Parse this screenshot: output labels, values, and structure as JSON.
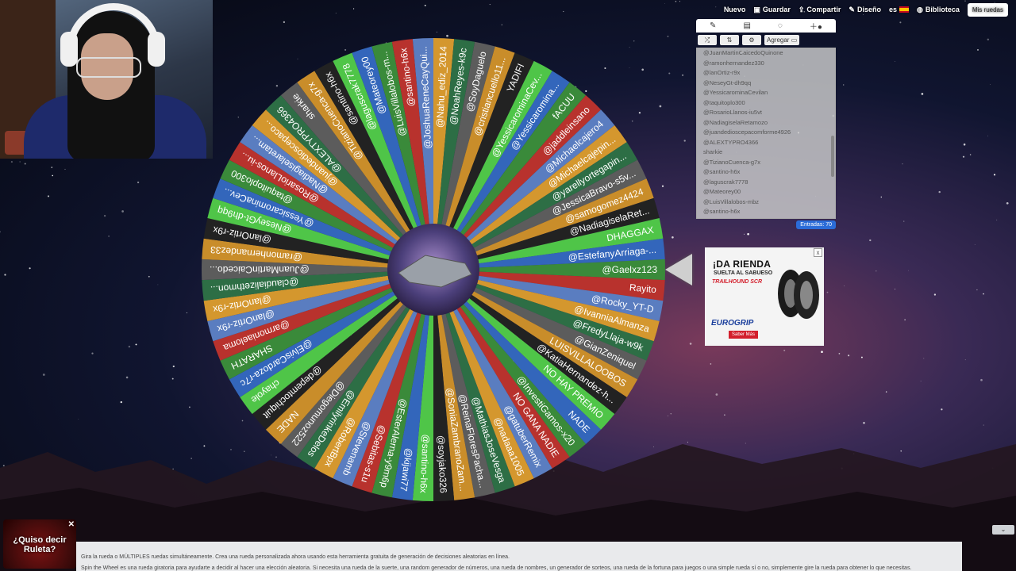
{
  "topnav": {
    "items": [
      {
        "label": "Nuevo",
        "icon": ""
      },
      {
        "label": "Guardar",
        "icon": "save-icon"
      },
      {
        "label": "Compartir",
        "icon": "share-icon"
      },
      {
        "label": "Diseño",
        "icon": "pen-icon"
      },
      {
        "label": "es",
        "icon": "flag-es-icon"
      },
      {
        "label": "Biblioteca",
        "icon": "globe-icon"
      }
    ],
    "my_wheels": "Mis ruedas"
  },
  "panel": {
    "add_label": "Agregar",
    "entries_count": "Entradas: 70",
    "entries": [
      "@JuanMartinCaicedoQuinone",
      "@ramonhernandez330",
      "@lanOrtiz-r9x",
      "@NeseyGt-dh9qq",
      "@YessicarominaCevilan",
      "@taquitoplo300",
      "@RosarioLlanos-iu5vt",
      "@NadiagiselaRetamozo",
      "@juandedioscepacomforme4926",
      "@ALEXTYPRO4366",
      "sharkie",
      "@TizianoCuenca-g7x",
      "@santino-h6x",
      "@laguscrak7778",
      "@Mateorey00",
      "@LuisVillalobos-mbz",
      "@santino-h6x"
    ]
  },
  "wheel": {
    "entries": [
      "@Gaelxz123",
      "Rayito",
      "@Rocky_YT-D",
      "@IvanniaAlmanza",
      "@FredyLlaja-w9k",
      "@GianZeniquel",
      "LUISVILLALOOBOS",
      "@KatiaHernandez-h...",
      "NO HAY PREMIO",
      "NADE",
      "@InvestiGamos-x20",
      "NO GANA NADIE",
      "@gatuberRemix",
      "@nadaaa1005",
      "@MathiasJoseVesga",
      "@ReinaFloresPacha...",
      "@SoniaZambranoZam...",
      "@soyjako326",
      "@santino-h6x",
      "@kijawi77",
      "@EsterAlerna-y9m6p",
      "@Sebitas-s1u",
      "@Stevenamb",
      "@RobertBpx",
      "@EmilyrinkeDelos",
      "@Diegomunoz522",
      "NADE",
      "@depemtochiquit",
      "chayole",
      "@ElvisCardoza-r7c",
      "SHARATH",
      "@armoniaeloma",
      "@lanOrtiz-r9x",
      "@lanOrtiz-r9x",
      "@claudializethmon...",
      "@JuanMartinCaicedo...",
      "@ramonhernandez33",
      "@lanOrtiz-r9x",
      "@NeseyGt-dh9qq",
      "@YessicarominaCev...",
      "@taquitoplo300",
      "@RosarioLlanos-iu...",
      "@Nadiagiselaretam...",
      "@juandedioscepaco...",
      "@ALEXTYPRO4366",
      "sharkie",
      "@TizianoCuenca-g7x",
      "@santino-h6x",
      "@laguscrak7778",
      "@Mateorey00",
      "@LuisVillalobos-m...",
      "@santino-h6x",
      "@JoshuaReneCayQui...",
      "@Nahu_ediz_2014",
      "@NoahReyes-k9c",
      "@SoyDaguelo",
      "@cristiancuello11...",
      "YADIFI",
      "@YessicarominaCev...",
      "@Yessicaromina...",
      "fACUU",
      "@jaddleinsano",
      "@Michaelcajero4",
      "@Michaelcajepin...",
      "@yarellyortegapin...",
      "@JessicaBravo-s5v...",
      "@samogomez4424",
      "@NadiagiselaRet...",
      "DHAGGAX",
      "@EstefanyArriaga-..."
    ],
    "colors": [
      "#3a8a3a",
      "#b8322d",
      "#5a7dc0",
      "#d4972e",
      "#2d6e45",
      "#5c5c5c",
      "#c98d2a",
      "#222222",
      "#4fc548",
      "#3366bb"
    ]
  },
  "ad": {
    "headline": "¡DA RIENDA",
    "subline": "SUELTA AL SABUESO",
    "product": "TRAILHOUND SCR",
    "brand": "EUROGRIP",
    "cta": "Saber Más",
    "close": "x"
  },
  "popup": {
    "text": "¿Quiso decir Ruleta?",
    "close": "✕"
  },
  "info": {
    "line1": "Gira la rueda o MÚLTIPLES ruedas simultáneamente. Crea una rueda personalizada ahora usando esta herramienta gratuita de generación de decisiones aleatorias en línea.",
    "line2": "Spin the Wheel es una rueda giratoria para ayudarte a decidir al hacer una elección aleatoria. Si necesita una rueda de la suerte, una random generador de números, una rueda de nombres, un generador de sorteos, una rueda de la fortuna para juegos o una simple rueda sí o no, simplemente gire la rueda para obtener lo que necesitas."
  },
  "collapse_icon": "chevron-down-icon"
}
